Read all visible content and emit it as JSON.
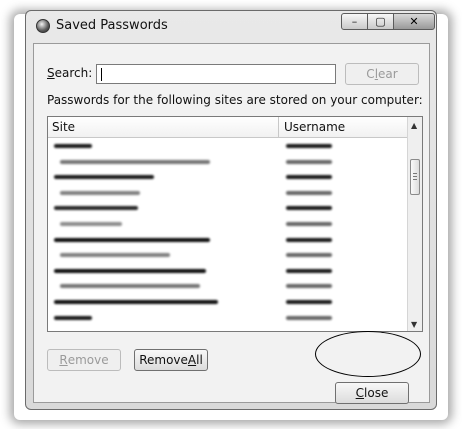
{
  "window": {
    "title": "Saved Passwords",
    "controls": {
      "minimize": "–",
      "maximize": "▢",
      "close": "✕"
    }
  },
  "search": {
    "label_prefix": "",
    "label_mnemonic": "S",
    "label_rest": "earch:",
    "value": ""
  },
  "buttons": {
    "clear": {
      "mn": "",
      "u": "l",
      "rest_pre": "C",
      "rest_post": "ear"
    },
    "remove": {
      "u": "R",
      "rest": "emove"
    },
    "remove_all": {
      "pre": "Remove ",
      "u": "A",
      "rest": "ll"
    },
    "close": {
      "u": "C",
      "rest": "lose"
    }
  },
  "info_text": "Passwords for the following sites are stored on your computer:",
  "list": {
    "columns": [
      "Site",
      "Username"
    ],
    "row_count": 12
  },
  "icons": {
    "app": "browser-icon",
    "scroll_up": "▲",
    "scroll_down": "▼"
  },
  "colors": {
    "background": "#f2f2f2",
    "window_frame": "#6b6b6b"
  }
}
